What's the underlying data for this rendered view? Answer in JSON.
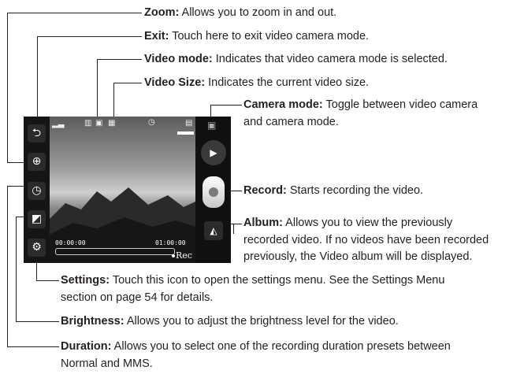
{
  "annotations": {
    "zoom": {
      "label": "Zoom:",
      "text": "Allows you to zoom in and out."
    },
    "exit": {
      "label": "Exit:",
      "text": "Touch here to exit video camera mode."
    },
    "video_mode": {
      "label": "Video mode:",
      "text": "Indicates that video camera mode is selected."
    },
    "video_size": {
      "label": "Video Size:",
      "text": "Indicates the current video size."
    },
    "camera_mode": {
      "label": "Camera mode:",
      "text": "Toggle between video camera",
      "text2": "and camera mode."
    },
    "record": {
      "label": "Record:",
      "text": "Starts recording the video."
    },
    "album": {
      "label": "Album:",
      "text": "Allows you to view the previously",
      "text2": "recorded video. If no videos have been recorded",
      "text3": "previously, the Video album will be displayed."
    },
    "settings": {
      "label": "Settings:",
      "text": "Touch this icon to open the settings menu. See the Settings Menu",
      "text2": "section on page 54 for details."
    },
    "brightness": {
      "label": "Brightness:",
      "text": "Allows you to adjust the brightness level for the video."
    },
    "duration": {
      "label": "Duration:",
      "text": "Allows you to select one of the recording duration presets between",
      "text2": "Normal and MMS."
    }
  },
  "screen": {
    "time_elapsed": "00:00:00",
    "time_total": "01:00:00",
    "rec_label": "Rec",
    "icons": [
      "back-icon",
      "zoom-icon",
      "timer-icon",
      "brightness-icon",
      "gear-icon",
      "camera-icon",
      "video-camera-icon",
      "album-icon"
    ]
  }
}
